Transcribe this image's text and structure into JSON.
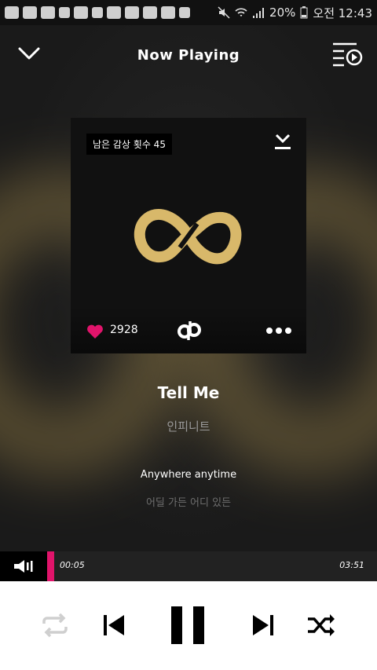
{
  "status_bar": {
    "time": "오전 12:43",
    "battery": "20%"
  },
  "header": {
    "title": "Now Playing"
  },
  "album": {
    "remaining_plays": "남은 감상 횟수 45",
    "likes": "2928",
    "accent_color": "#e1146b",
    "logo_color": "#d8b86a"
  },
  "song": {
    "title": "Tell Me",
    "artist": "인피니트"
  },
  "lyrics": {
    "current": "Anywhere anytime",
    "next": "어딜 가든 어디 있든"
  },
  "playback": {
    "elapsed": "00:05",
    "total": "03:51",
    "progress": 0.022
  },
  "controls": {
    "repeat_enabled": false,
    "shuffle_enabled": true,
    "state": "playing"
  }
}
